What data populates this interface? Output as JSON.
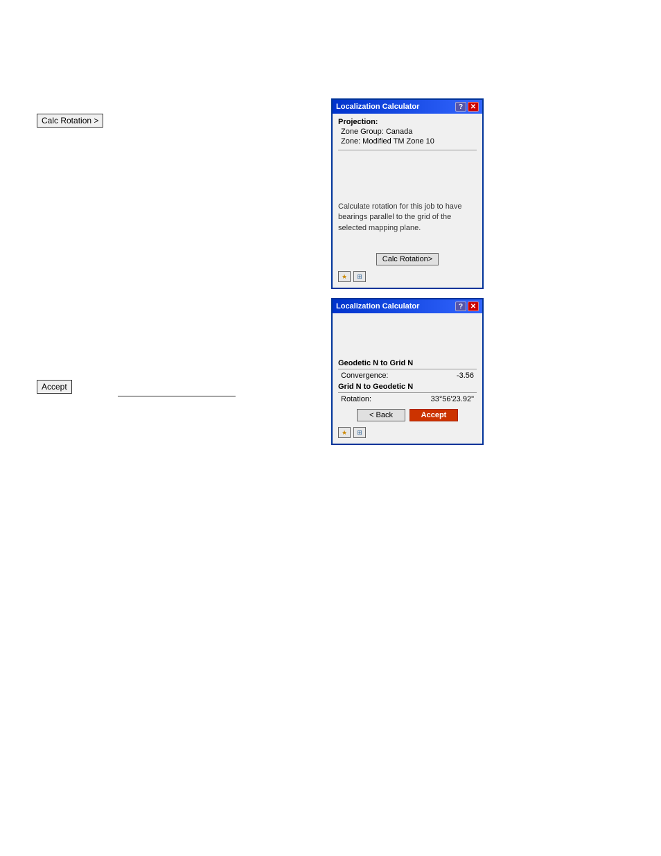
{
  "left_panel": {
    "calc_rotation_label": "Calc Rotation >",
    "accept_label": "Accept"
  },
  "dialog1": {
    "title": "Localization Calculator",
    "section_projection": "Projection:",
    "zone_group": "Zone Group: Canada",
    "zone": "Zone: Modified TM Zone 10",
    "description": "Calculate rotation for this job to have bearings parallel to the grid of the selected mapping plane.",
    "calc_button": "Calc Rotation>",
    "icons": {
      "star": "★",
      "grid": "⊞"
    }
  },
  "dialog2": {
    "title": "Localization Calculator",
    "section_geodetic_to_grid": "Geodetic N to Grid N",
    "convergence_label": "Convergence:",
    "convergence_value": "-3.56",
    "section_grid_to_geodetic": "Grid N to Geodetic N",
    "rotation_label": "Rotation:",
    "rotation_value": "33°56'23.92\"",
    "back_button": "< Back",
    "accept_button": "Accept",
    "icons": {
      "star": "★",
      "grid": "⊞"
    }
  }
}
